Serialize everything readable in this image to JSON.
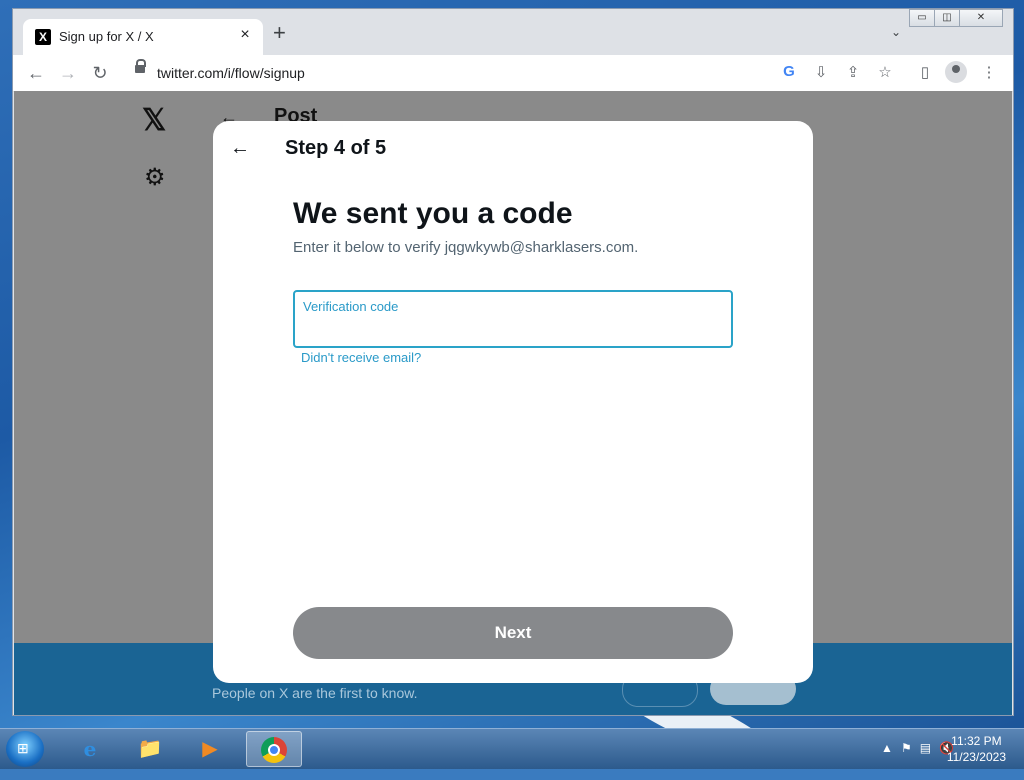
{
  "browser": {
    "tab": {
      "favicon": "X",
      "title": "Sign up for X / X",
      "close": "×"
    },
    "new_tab": "+",
    "tab_menu": "⌄",
    "window_controls": {
      "minimize": "▭",
      "restore": "◫",
      "close": "✕"
    },
    "toolbar": {
      "back": "←",
      "forward": "→",
      "reload": "↻",
      "url": "twitter.com/i/flow/signup",
      "google": "G",
      "install": "⇩",
      "share": "⇪",
      "bookmark": "☆",
      "side_panel": "▯",
      "menu": "⋮"
    }
  },
  "background_page": {
    "logo": "𝕏",
    "settings": "⚙",
    "back": "←",
    "header": "Post",
    "banner_text": "People on X are the first to know."
  },
  "modal": {
    "back": "←",
    "step": "Step 4 of 5",
    "title": "We sent you a code",
    "subtitle": "Enter it below to verify jqgwkywb@sharklasers.com.",
    "field_label": "Verification code",
    "field_value": "",
    "resend_link": "Didn't receive email?",
    "next_button": "Next"
  },
  "taskbar": {
    "start": "⊞",
    "apps": [
      {
        "name": "internet-explorer",
        "glyph": "e"
      },
      {
        "name": "file-explorer",
        "glyph": "📁"
      },
      {
        "name": "media-player",
        "glyph": "▶"
      },
      {
        "name": "chrome",
        "glyph": ""
      }
    ],
    "tray": {
      "show_hidden": "▲",
      "flag": "⚑",
      "network": "▤",
      "volume": "🔇"
    },
    "clock": {
      "time": "11:32 PM",
      "date": "11/23/2023"
    }
  }
}
